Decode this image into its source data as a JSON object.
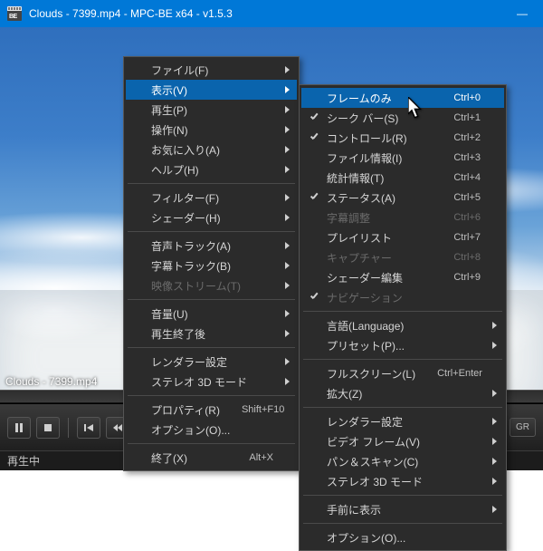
{
  "title": "Clouds - 7399.mp4 - MPC-BE x64 - v1.5.3",
  "overlay_filename": "Clouds - 7399.mp4",
  "status_text": "再生中",
  "gr_button": "GR",
  "main_menu": [
    {
      "label": "ファイル(F)",
      "arrow": true
    },
    {
      "label": "表示(V)",
      "arrow": true,
      "hover": true
    },
    {
      "label": "再生(P)",
      "arrow": true
    },
    {
      "label": "操作(N)",
      "arrow": true
    },
    {
      "label": "お気に入り(A)",
      "arrow": true
    },
    {
      "label": "ヘルプ(H)",
      "arrow": true
    },
    {
      "sep": true
    },
    {
      "label": "フィルター(F)",
      "arrow": true
    },
    {
      "label": "シェーダー(H)",
      "arrow": true
    },
    {
      "sep": true
    },
    {
      "label": "音声トラック(A)",
      "arrow": true
    },
    {
      "label": "字幕トラック(B)",
      "arrow": true
    },
    {
      "label": "映像ストリーム(T)",
      "arrow": true,
      "disabled": true
    },
    {
      "sep": true
    },
    {
      "label": "音量(U)",
      "arrow": true
    },
    {
      "label": "再生終了後",
      "arrow": true
    },
    {
      "sep": true
    },
    {
      "label": "レンダラー設定",
      "arrow": true
    },
    {
      "label": "ステレオ 3D モード",
      "arrow": true
    },
    {
      "sep": true
    },
    {
      "label": "プロパティ(R)",
      "accel": "Shift+F10"
    },
    {
      "label": "オプション(O)..."
    },
    {
      "sep": true
    },
    {
      "label": "終了(X)",
      "accel": "Alt+X"
    }
  ],
  "sub_menu": [
    {
      "label": "フレームのみ",
      "accel": "Ctrl+0",
      "hover": true
    },
    {
      "label": "シーク バー(S)",
      "accel": "Ctrl+1",
      "checked": true
    },
    {
      "label": "コントロール(R)",
      "accel": "Ctrl+2",
      "checked": true
    },
    {
      "label": "ファイル情報(I)",
      "accel": "Ctrl+3"
    },
    {
      "label": "統計情報(T)",
      "accel": "Ctrl+4"
    },
    {
      "label": "ステータス(A)",
      "accel": "Ctrl+5",
      "checked": true
    },
    {
      "label": "字幕調整",
      "accel": "Ctrl+6",
      "disabled": true
    },
    {
      "label": "プレイリスト",
      "accel": "Ctrl+7"
    },
    {
      "label": "キャプチャー",
      "accel": "Ctrl+8",
      "disabled": true
    },
    {
      "label": "シェーダー編集",
      "accel": "Ctrl+9"
    },
    {
      "label": "ナビゲーション",
      "disabled": true,
      "checked": true
    },
    {
      "sep": true
    },
    {
      "label": "言語(Language)",
      "arrow": true
    },
    {
      "label": "プリセット(P)...",
      "arrow": true
    },
    {
      "sep": true
    },
    {
      "label": "フルスクリーン(L)",
      "accel": "Ctrl+Enter"
    },
    {
      "label": "拡大(Z)",
      "arrow": true
    },
    {
      "sep": true
    },
    {
      "label": "レンダラー設定",
      "arrow": true
    },
    {
      "label": "ビデオ フレーム(V)",
      "arrow": true
    },
    {
      "label": "パン＆スキャン(C)",
      "arrow": true
    },
    {
      "label": "ステレオ 3D モード",
      "arrow": true
    },
    {
      "sep": true
    },
    {
      "label": "手前に表示",
      "arrow": true
    },
    {
      "sep": true
    },
    {
      "label": "オプション(O)..."
    }
  ]
}
